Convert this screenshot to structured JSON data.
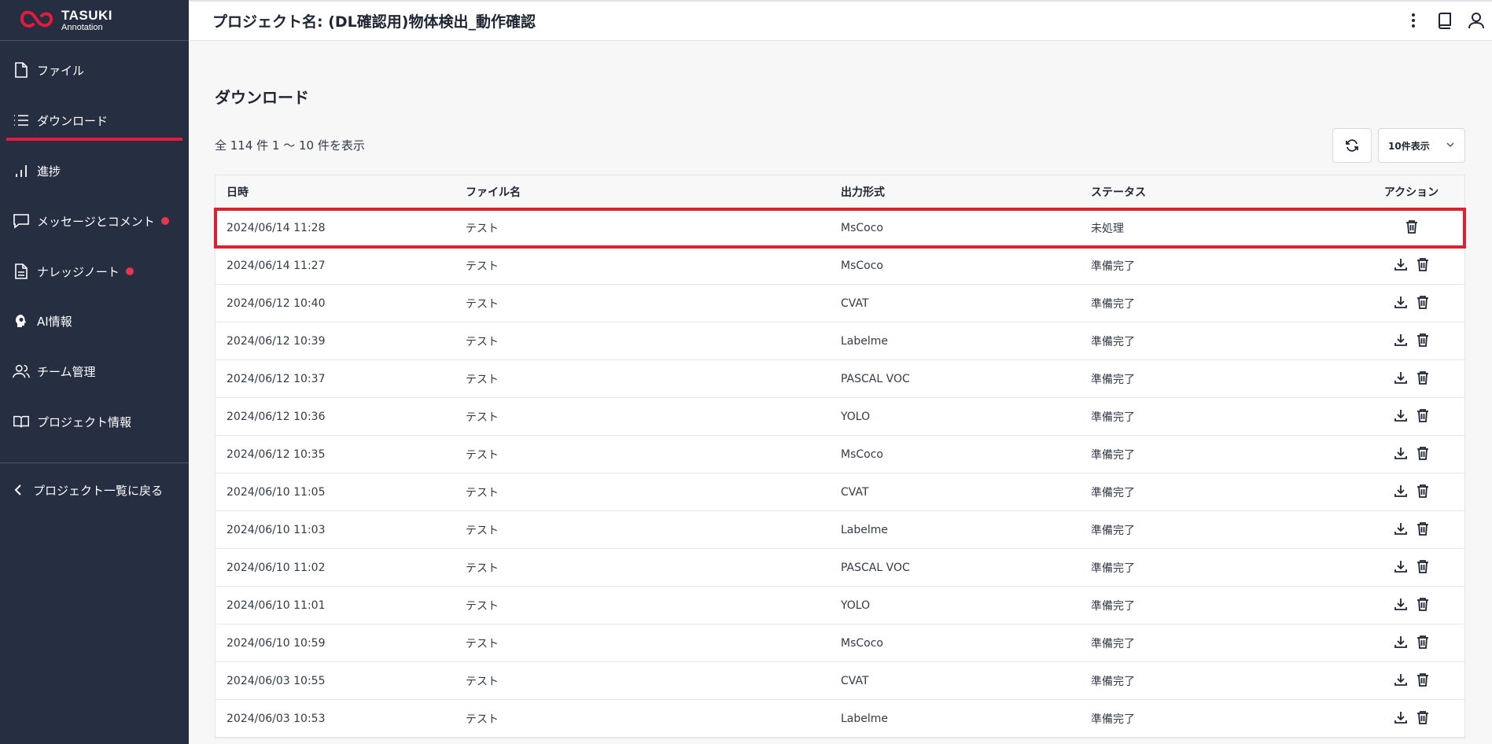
{
  "app": {
    "logo_title": "TASUKI",
    "logo_subtitle": "Annotation",
    "brand_color": "#e8193e"
  },
  "sidebar": {
    "items": [
      {
        "label": "ファイル",
        "icon": "file-icon"
      },
      {
        "label": "ダウンロード",
        "icon": "list-icon",
        "active": true
      },
      {
        "label": "進捗",
        "icon": "bar-chart-icon"
      },
      {
        "label": "メッセージとコメント",
        "icon": "message-icon",
        "badge": true
      },
      {
        "label": "ナレッジノート",
        "icon": "document-icon",
        "badge": true
      },
      {
        "label": "AI情報",
        "icon": "ai-head-icon"
      },
      {
        "label": "チーム管理",
        "icon": "team-icon"
      },
      {
        "label": "プロジェクト情報",
        "icon": "book-icon"
      }
    ],
    "back_label": "プロジェクト一覧に戻る"
  },
  "header": {
    "title": "プロジェクト名: (DL確認用)物体検出_動作確認"
  },
  "main": {
    "title": "ダウンロード",
    "summary": "全 114 件 1 〜 10 件を表示",
    "per_page": "10件表示"
  },
  "table": {
    "columns": [
      "日時",
      "ファイル名",
      "出力形式",
      "ステータス",
      "アクション"
    ],
    "rows": [
      {
        "date": "2024/06/14 11:28",
        "file": "テスト",
        "format": "MsCoco",
        "status": "未処理",
        "download": false
      },
      {
        "date": "2024/06/14 11:27",
        "file": "テスト",
        "format": "MsCoco",
        "status": "準備完了",
        "download": true
      },
      {
        "date": "2024/06/12 10:40",
        "file": "テスト",
        "format": "CVAT",
        "status": "準備完了",
        "download": true
      },
      {
        "date": "2024/06/12 10:39",
        "file": "テスト",
        "format": "Labelme",
        "status": "準備完了",
        "download": true
      },
      {
        "date": "2024/06/12 10:37",
        "file": "テスト",
        "format": "PASCAL VOC",
        "status": "準備完了",
        "download": true
      },
      {
        "date": "2024/06/12 10:36",
        "file": "テスト",
        "format": "YOLO",
        "status": "準備完了",
        "download": true
      },
      {
        "date": "2024/06/12 10:35",
        "file": "テスト",
        "format": "MsCoco",
        "status": "準備完了",
        "download": true
      },
      {
        "date": "2024/06/10 11:05",
        "file": "テスト",
        "format": "CVAT",
        "status": "準備完了",
        "download": true
      },
      {
        "date": "2024/06/10 11:03",
        "file": "テスト",
        "format": "Labelme",
        "status": "準備完了",
        "download": true
      },
      {
        "date": "2024/06/10 11:02",
        "file": "テスト",
        "format": "PASCAL VOC",
        "status": "準備完了",
        "download": true
      },
      {
        "date": "2024/06/10 11:01",
        "file": "テスト",
        "format": "YOLO",
        "status": "準備完了",
        "download": true
      },
      {
        "date": "2024/06/10 10:59",
        "file": "テスト",
        "format": "MsCoco",
        "status": "準備完了",
        "download": true
      },
      {
        "date": "2024/06/03 10:55",
        "file": "テスト",
        "format": "CVAT",
        "status": "準備完了",
        "download": true
      },
      {
        "date": "2024/06/03 10:53",
        "file": "テスト",
        "format": "Labelme",
        "status": "準備完了",
        "download": true
      }
    ]
  }
}
